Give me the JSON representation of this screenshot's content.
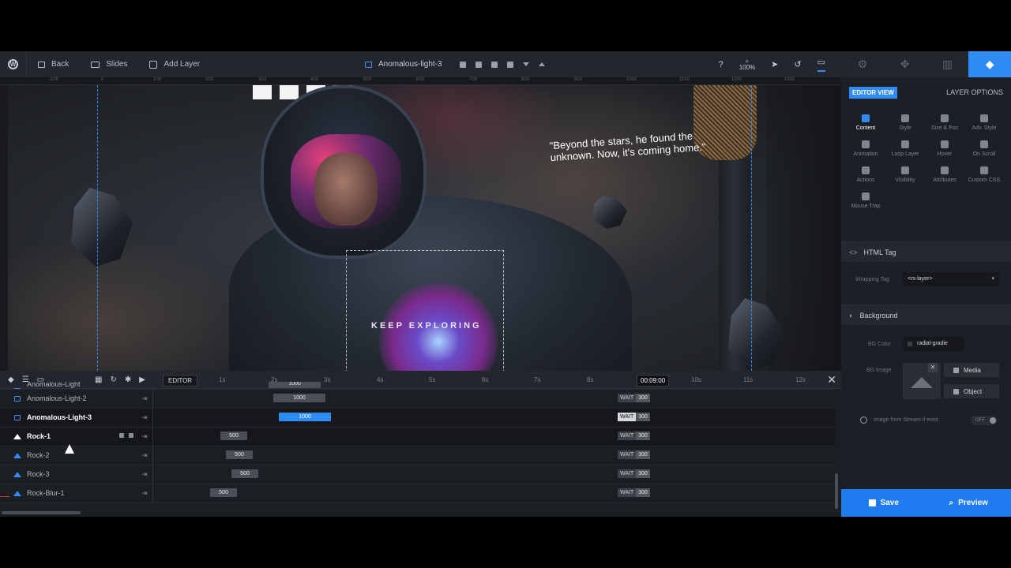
{
  "toolbar": {
    "back": "Back",
    "slides": "Slides",
    "add_layer": "Add Layer",
    "layer_title": "Anomalous-light-3",
    "zoom": "100%"
  },
  "ruler_marks": [
    "-100",
    "0",
    "100",
    "200",
    "300",
    "400",
    "500",
    "600",
    "700",
    "800",
    "900",
    "1000",
    "1100",
    "1200",
    "1300"
  ],
  "canvas": {
    "quote": "\"Beyond the stars, he found the unknown. Now, it's coming home.\"",
    "keep_text": "KEEP EXPLORING"
  },
  "timeline": {
    "editor_label": "EDITOR",
    "ticks": [
      "1s",
      "2s",
      "3s",
      "4s",
      "5s",
      "6s",
      "7s",
      "8s",
      "9s",
      "10s",
      "11s",
      "12s"
    ],
    "current_time": "00:09:00",
    "wait_label": "WAIT",
    "rows": [
      {
        "name": "Anomalous-Light",
        "type": "layer",
        "bar": "1000"
      },
      {
        "name": "Anomalous-Light-2",
        "type": "layer",
        "bar": "1000",
        "wait": "300"
      },
      {
        "name": "Anomalous-Light-3",
        "type": "layer",
        "bar": "1000",
        "wait": "300",
        "active": true
      },
      {
        "name": "Rock-1",
        "type": "image",
        "bar": "500",
        "wait": "300"
      },
      {
        "name": "Rock-2",
        "type": "image",
        "bar": "500",
        "wait": "300"
      },
      {
        "name": "Rock-3",
        "type": "image",
        "bar": "500",
        "wait": "300"
      },
      {
        "name": "Rock-Blur-1",
        "type": "image",
        "bar": "500",
        "wait": "300"
      }
    ]
  },
  "panel": {
    "editor_view": "EDITOR VIEW",
    "layer_options": "LAYER OPTIONS",
    "options": [
      "Content",
      "Style",
      "Size & Pos",
      "Adv. Style",
      "Animation",
      "Loop Layer",
      "Hover",
      "On Scroll",
      "Actions",
      "Visibility",
      "Attributes",
      "Custom CSS",
      "Mouse Trap"
    ],
    "html_tag_section": "HTML Tag",
    "wrapping_tag_label": "Wrapping Tag",
    "wrapping_tag_value": "<rs-layer>",
    "background_section": "Background",
    "bg_color_label": "BG Color",
    "bg_color_value": "radial-gradie",
    "bg_image_label": "BG Image",
    "media_btn": "Media",
    "object_btn": "Object",
    "stream_label": "Image from Stream if exist",
    "stream_toggle": "OFF",
    "save": "Save",
    "preview": "Preview"
  },
  "colors": {
    "accent": "#2f8cf5",
    "toolbar": "#23262d",
    "panel": "#1c1f25"
  }
}
